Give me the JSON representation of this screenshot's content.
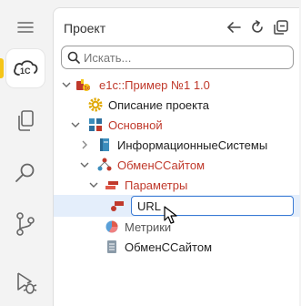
{
  "panel": {
    "title": "Проект",
    "search_placeholder": "Искать..."
  },
  "tree": {
    "root_label": "e1c::Пример №1 1.0",
    "project_description": "Описание проекта",
    "main_label": "Основной",
    "info_systems": "ИнформационныеСистемы",
    "exchange": "ОбменССайтом",
    "parameters": "Параметры",
    "url_value": "URL",
    "metrics": "Метрики",
    "exchange_module": "ОбменССайтом"
  },
  "activity_bar": {
    "items": [
      "menu-icon",
      "1c-icon",
      "files-icon",
      "search-icon",
      "source-control-icon",
      "run-debug-icon"
    ]
  },
  "colors": {
    "accent": "#f5c518",
    "selection": "#e4eefb",
    "red_text": "#c0392b",
    "focus_border": "#3a7bd5"
  }
}
